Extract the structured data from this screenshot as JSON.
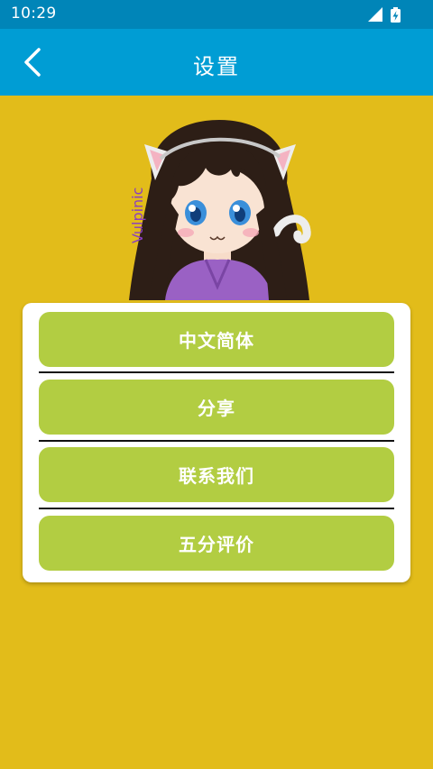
{
  "status_bar": {
    "time": "10:29",
    "icons": [
      "signal-icon",
      "battery-charging-icon"
    ]
  },
  "app_bar": {
    "title": "设置",
    "back_icon": "chevron-left-icon"
  },
  "avatar": {
    "label": "Vulpinic"
  },
  "menu": {
    "items": [
      {
        "label": "中文简体"
      },
      {
        "label": "分享"
      },
      {
        "label": "联系我们"
      },
      {
        "label": "五分评价"
      }
    ]
  },
  "colors": {
    "background": "#E2BC1A",
    "status_bar": "#0085B8",
    "app_bar": "#009DD4",
    "button": "#B2CD42",
    "card": "#FFFFFF"
  }
}
